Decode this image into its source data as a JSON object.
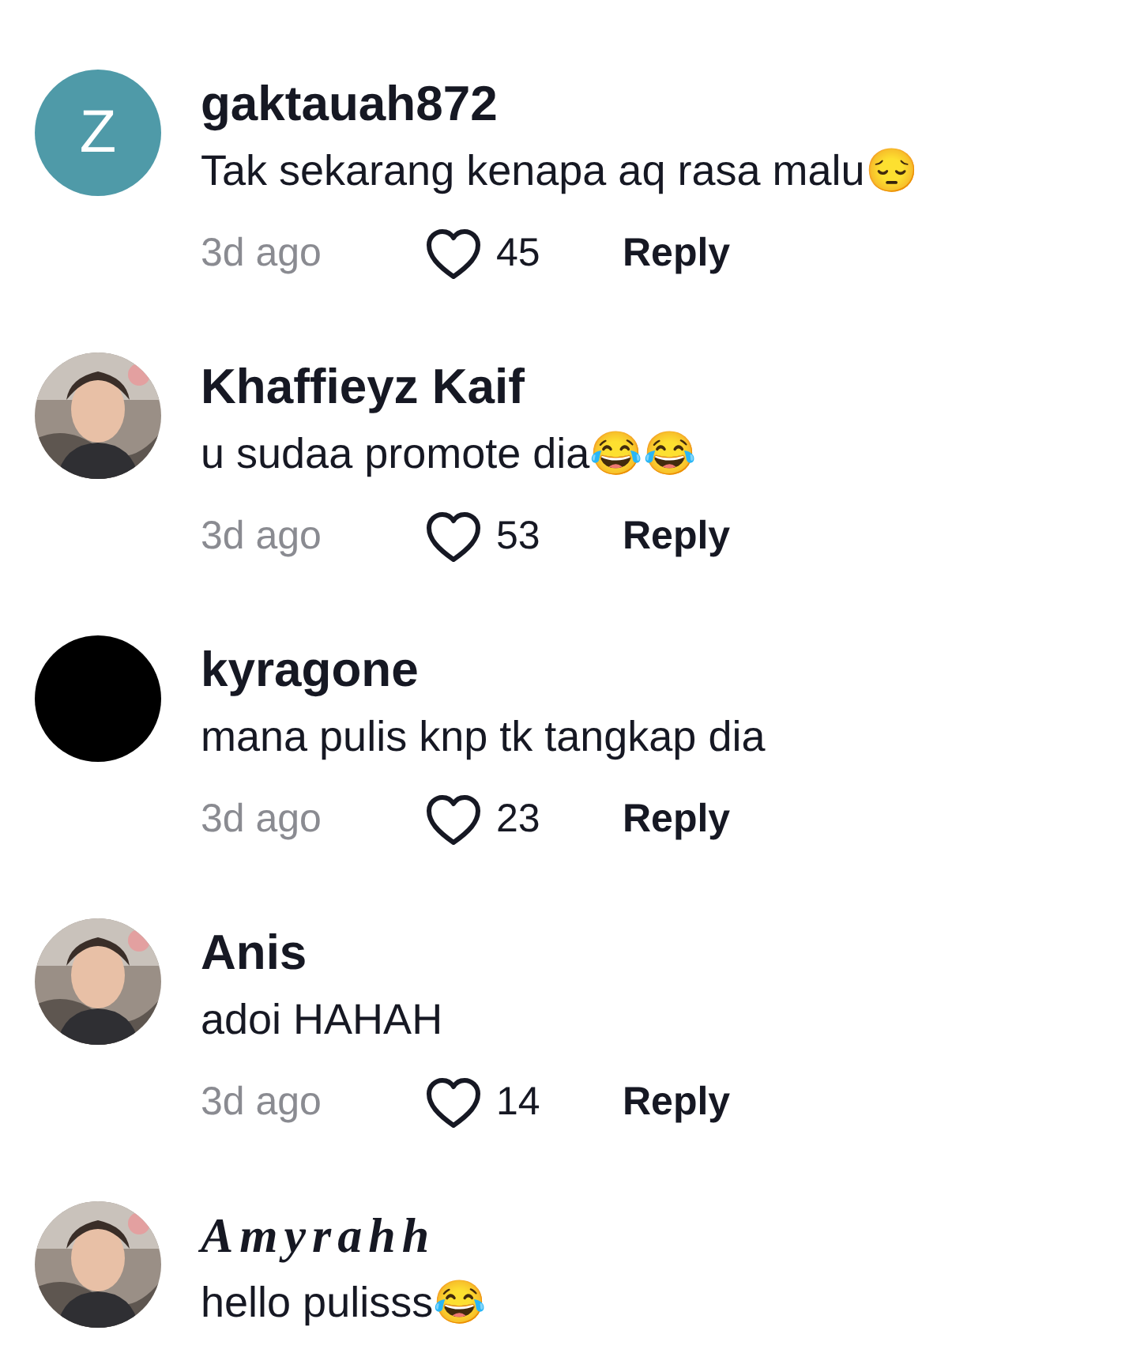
{
  "comments": [
    {
      "avatar": {
        "kind": "letter",
        "letter": "Z",
        "color": "#4f9aa8"
      },
      "username": "gaktauah872",
      "text": "Tak sekarang kenapa aq rasa malu😔",
      "time": "3d ago",
      "likes": "45",
      "liked": false,
      "reply": "Reply"
    },
    {
      "username": "Khaffieyz Kaif",
      "text": "u sudaa promote dia😂😂",
      "time": "3d ago",
      "likes": "53",
      "liked": false,
      "reply": "Reply"
    },
    {
      "avatar": {
        "kind": "plain",
        "color": "#000000"
      },
      "username": "kyragone",
      "text": "mana pulis knp tk tangkap dia",
      "time": "3d ago",
      "likes": "23",
      "liked": false,
      "reply": "Reply"
    },
    {
      "username": "Anis",
      "text": "adoi HAHAH",
      "time": "3d ago",
      "likes": "14",
      "liked": false,
      "reply": "Reply"
    },
    {
      "username": "Amyrahh",
      "stylized": true,
      "text": "hello pulisss😂"
    }
  ]
}
